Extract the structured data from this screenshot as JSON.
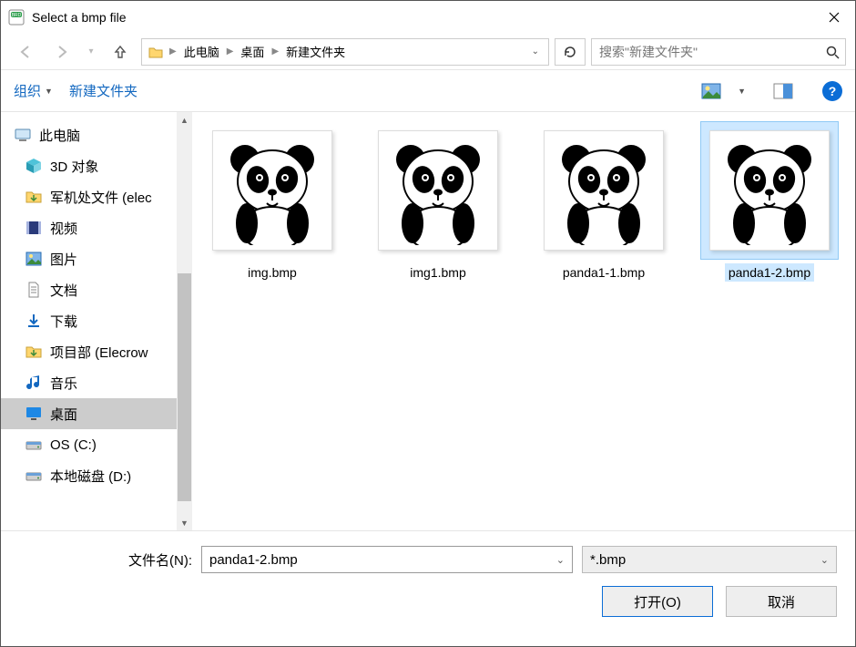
{
  "window": {
    "title": "Select a bmp file"
  },
  "breadcrumb": {
    "items": [
      "此电脑",
      "桌面",
      "新建文件夹"
    ]
  },
  "search": {
    "placeholder": "搜索\"新建文件夹\""
  },
  "toolbar": {
    "organize": "组织",
    "new_folder": "新建文件夹"
  },
  "sidebar": {
    "root": "此电脑",
    "items": [
      {
        "label": "3D 对象",
        "icon": "cube-icon"
      },
      {
        "label": "军机处文件 (elec",
        "icon": "folder-down-icon"
      },
      {
        "label": "视频",
        "icon": "film-icon"
      },
      {
        "label": "图片",
        "icon": "picture-icon"
      },
      {
        "label": "文档",
        "icon": "document-icon"
      },
      {
        "label": "下载",
        "icon": "download-icon"
      },
      {
        "label": "项目部 (Elecrow",
        "icon": "folder-down-icon"
      },
      {
        "label": "音乐",
        "icon": "music-icon"
      },
      {
        "label": "桌面",
        "icon": "desktop-icon",
        "selected": true
      },
      {
        "label": "OS (C:)",
        "icon": "drive-icon"
      },
      {
        "label": "本地磁盘 (D:)",
        "icon": "drive-icon"
      }
    ]
  },
  "files": [
    {
      "name": "img.bmp",
      "selected": false
    },
    {
      "name": "img1.bmp",
      "selected": false
    },
    {
      "name": "panda1-1.bmp",
      "selected": false
    },
    {
      "name": "panda1-2.bmp",
      "selected": true
    }
  ],
  "bottom": {
    "filename_label": "文件名(N):",
    "filename_value": "panda1-2.bmp",
    "filter_value": "*.bmp",
    "open_label": "打开(O)",
    "cancel_label": "取消"
  }
}
